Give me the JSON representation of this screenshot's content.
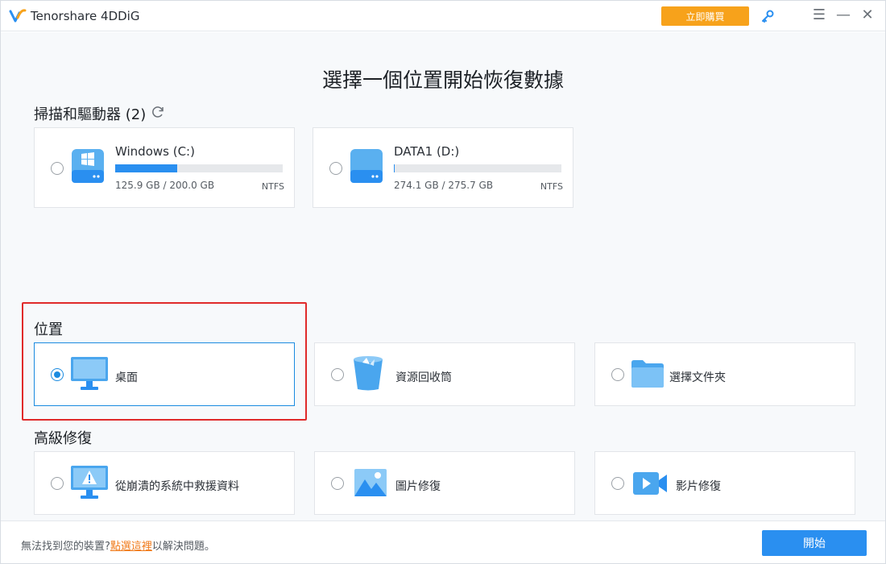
{
  "app": {
    "title": "Tenorshare 4DDiG",
    "buy_label": "立即購買",
    "icons": [
      "key-icon",
      "menu-icon",
      "minimize-icon",
      "close-icon"
    ]
  },
  "main": {
    "title": "選擇一個位置開始恢復數據",
    "drives_heading": "掃描和驅動器 (2)",
    "drives": [
      {
        "name": "Windows (C:)",
        "size": "125.9 GB / 200.0 GB",
        "fs": "NTFS",
        "used_fraction": 0.37,
        "icon": "windows-drive-icon"
      },
      {
        "name": "DATA1 (D:)",
        "size": "274.1 GB / 275.7 GB",
        "fs": "NTFS",
        "used_fraction": 0.005,
        "icon": "drive-icon"
      }
    ],
    "location_heading": "位置",
    "locations": [
      {
        "label": "桌面",
        "icon": "desktop-monitor-icon",
        "selected": true
      },
      {
        "label": "資源回收筒",
        "icon": "recycle-bin-icon",
        "selected": false
      },
      {
        "label": "選擇文件夾",
        "icon": "folder-icon",
        "selected": false
      }
    ],
    "advanced_heading": "高級修復",
    "advanced": [
      {
        "label": "從崩潰的系統中救援資料",
        "icon": "crashed-system-icon"
      },
      {
        "label": "圖片修復",
        "icon": "image-icon"
      },
      {
        "label": "影片修復",
        "icon": "video-icon"
      }
    ]
  },
  "footer": {
    "prefix": "無法找到您的裝置?",
    "link": "點選這裡",
    "suffix": "以解決問題。",
    "start_label": "開始"
  },
  "colors": {
    "accent": "#2a8ff0",
    "buy": "#f7a21b",
    "link": "#f07a1a",
    "highlight": "#e02a2a"
  }
}
